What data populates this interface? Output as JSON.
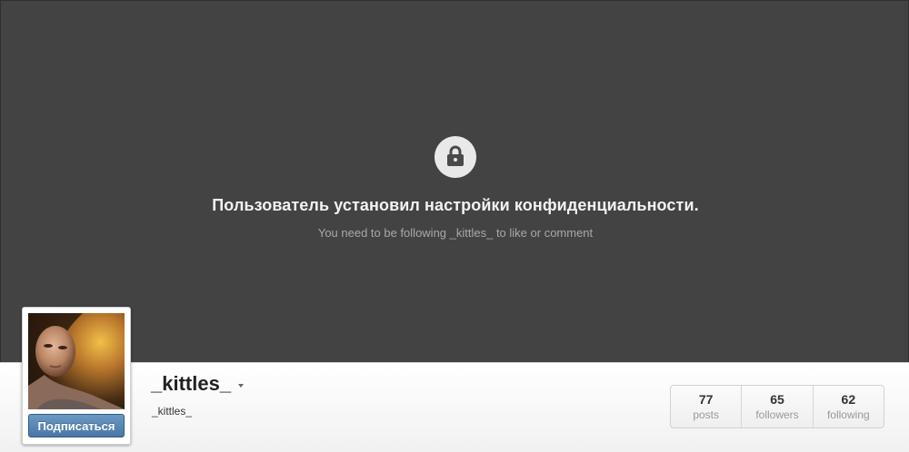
{
  "private_notice": {
    "icon": "lock-icon",
    "title": "Пользователь установил настройки конфиденциальности.",
    "subtitle": "You need to be following _kittles_ to like or comment"
  },
  "profile": {
    "username": "_kittles_",
    "full_name": "_kittles_",
    "follow_button_label": "Подписаться",
    "avatar_icon": "avatar-photo"
  },
  "stats": [
    {
      "value": "77",
      "label": "posts"
    },
    {
      "value": "65",
      "label": "followers"
    },
    {
      "value": "62",
      "label": "following"
    }
  ],
  "colors": {
    "banner_background": "#434343",
    "follow_button": "#5a88b6",
    "profile_bar": "#ffffff"
  }
}
